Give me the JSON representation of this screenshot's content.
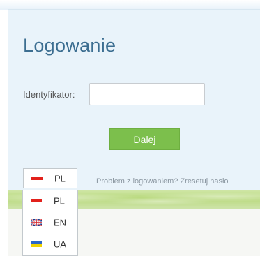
{
  "login": {
    "title": "Logowanie",
    "identifier_label": "Identyfikator:",
    "identifier_value": "",
    "next_label": "Dalej",
    "reset_text": "Problem z logowaniem? Zresetuj hasło"
  },
  "language": {
    "selected": "PL",
    "options": [
      {
        "code": "PL",
        "flag": "poland-flag-icon"
      },
      {
        "code": "EN",
        "flag": "uk-flag-icon"
      },
      {
        "code": "UA",
        "flag": "ukraine-flag-icon"
      }
    ]
  },
  "colors": {
    "title": "#3c6e91",
    "next_button": "#7cbf4c",
    "panel_background": "#e9f3fa"
  }
}
